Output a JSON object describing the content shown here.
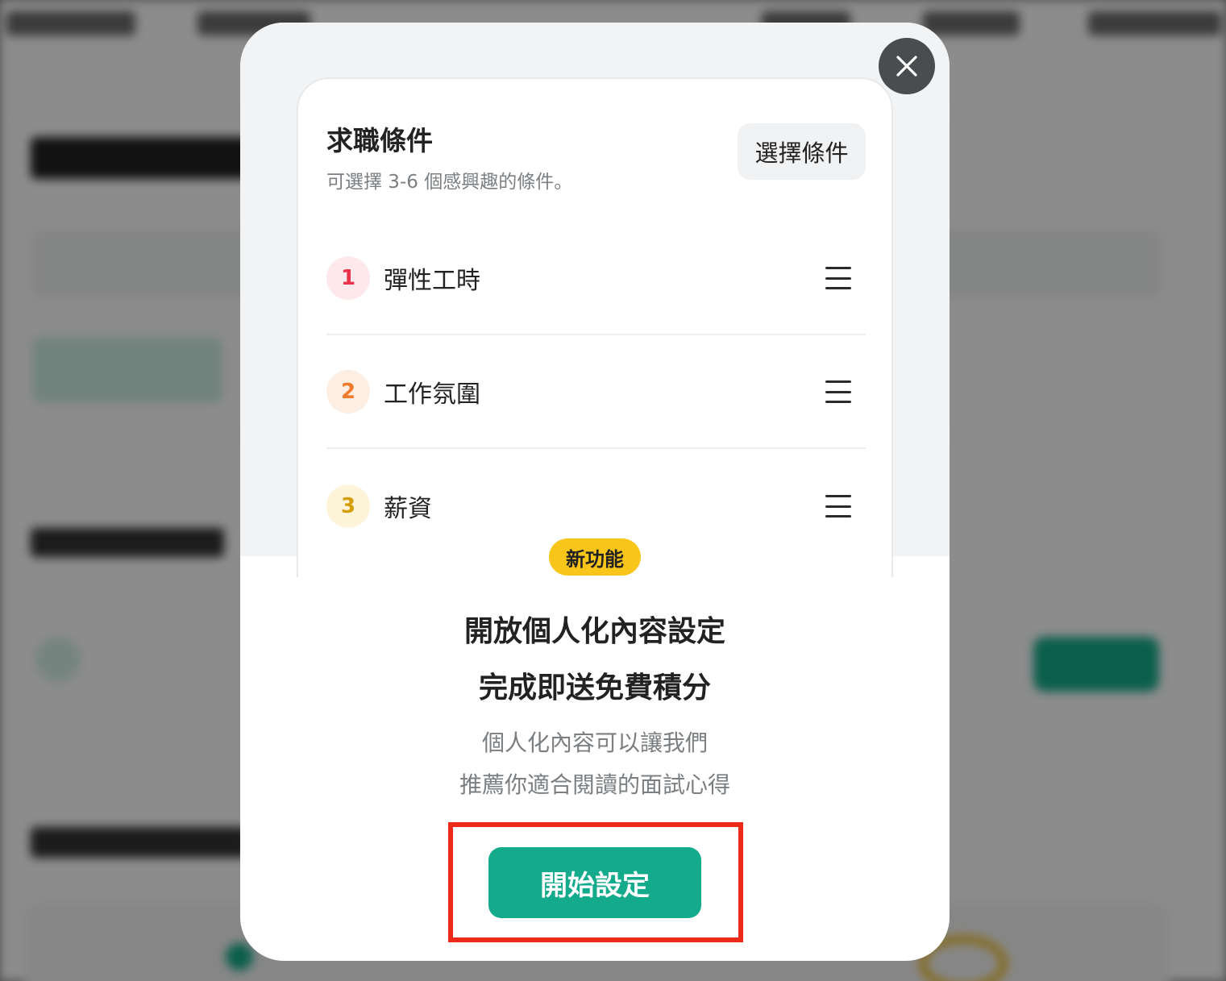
{
  "modal": {
    "preview": {
      "title": "求職條件",
      "subtitle": "可選擇 3-6 個感興趣的條件。",
      "select_button": "選擇條件",
      "conditions": [
        {
          "number": "1",
          "label": "彈性工時",
          "num_color": "#e8334a",
          "num_bg": "#fde9ec"
        },
        {
          "number": "2",
          "label": "工作氛圍",
          "num_color": "#ee7a2a",
          "num_bg": "#fdeee3"
        },
        {
          "number": "3",
          "label": "薪資",
          "num_color": "#d89e07",
          "num_bg": "#fdf4d9"
        }
      ]
    },
    "badge": "新功能",
    "headline_1": "開放個人化內容設定",
    "headline_2": "完成即送免費積分",
    "desc_1": "個人化內容可以讓我們",
    "desc_2": "推薦你適合閱讀的面試心得",
    "start_button": "開始設定",
    "close_icon": "close-icon"
  },
  "colors": {
    "primary": "#13ab8b",
    "badge": "#f8c61a",
    "highlight": "#ee2a1a"
  }
}
